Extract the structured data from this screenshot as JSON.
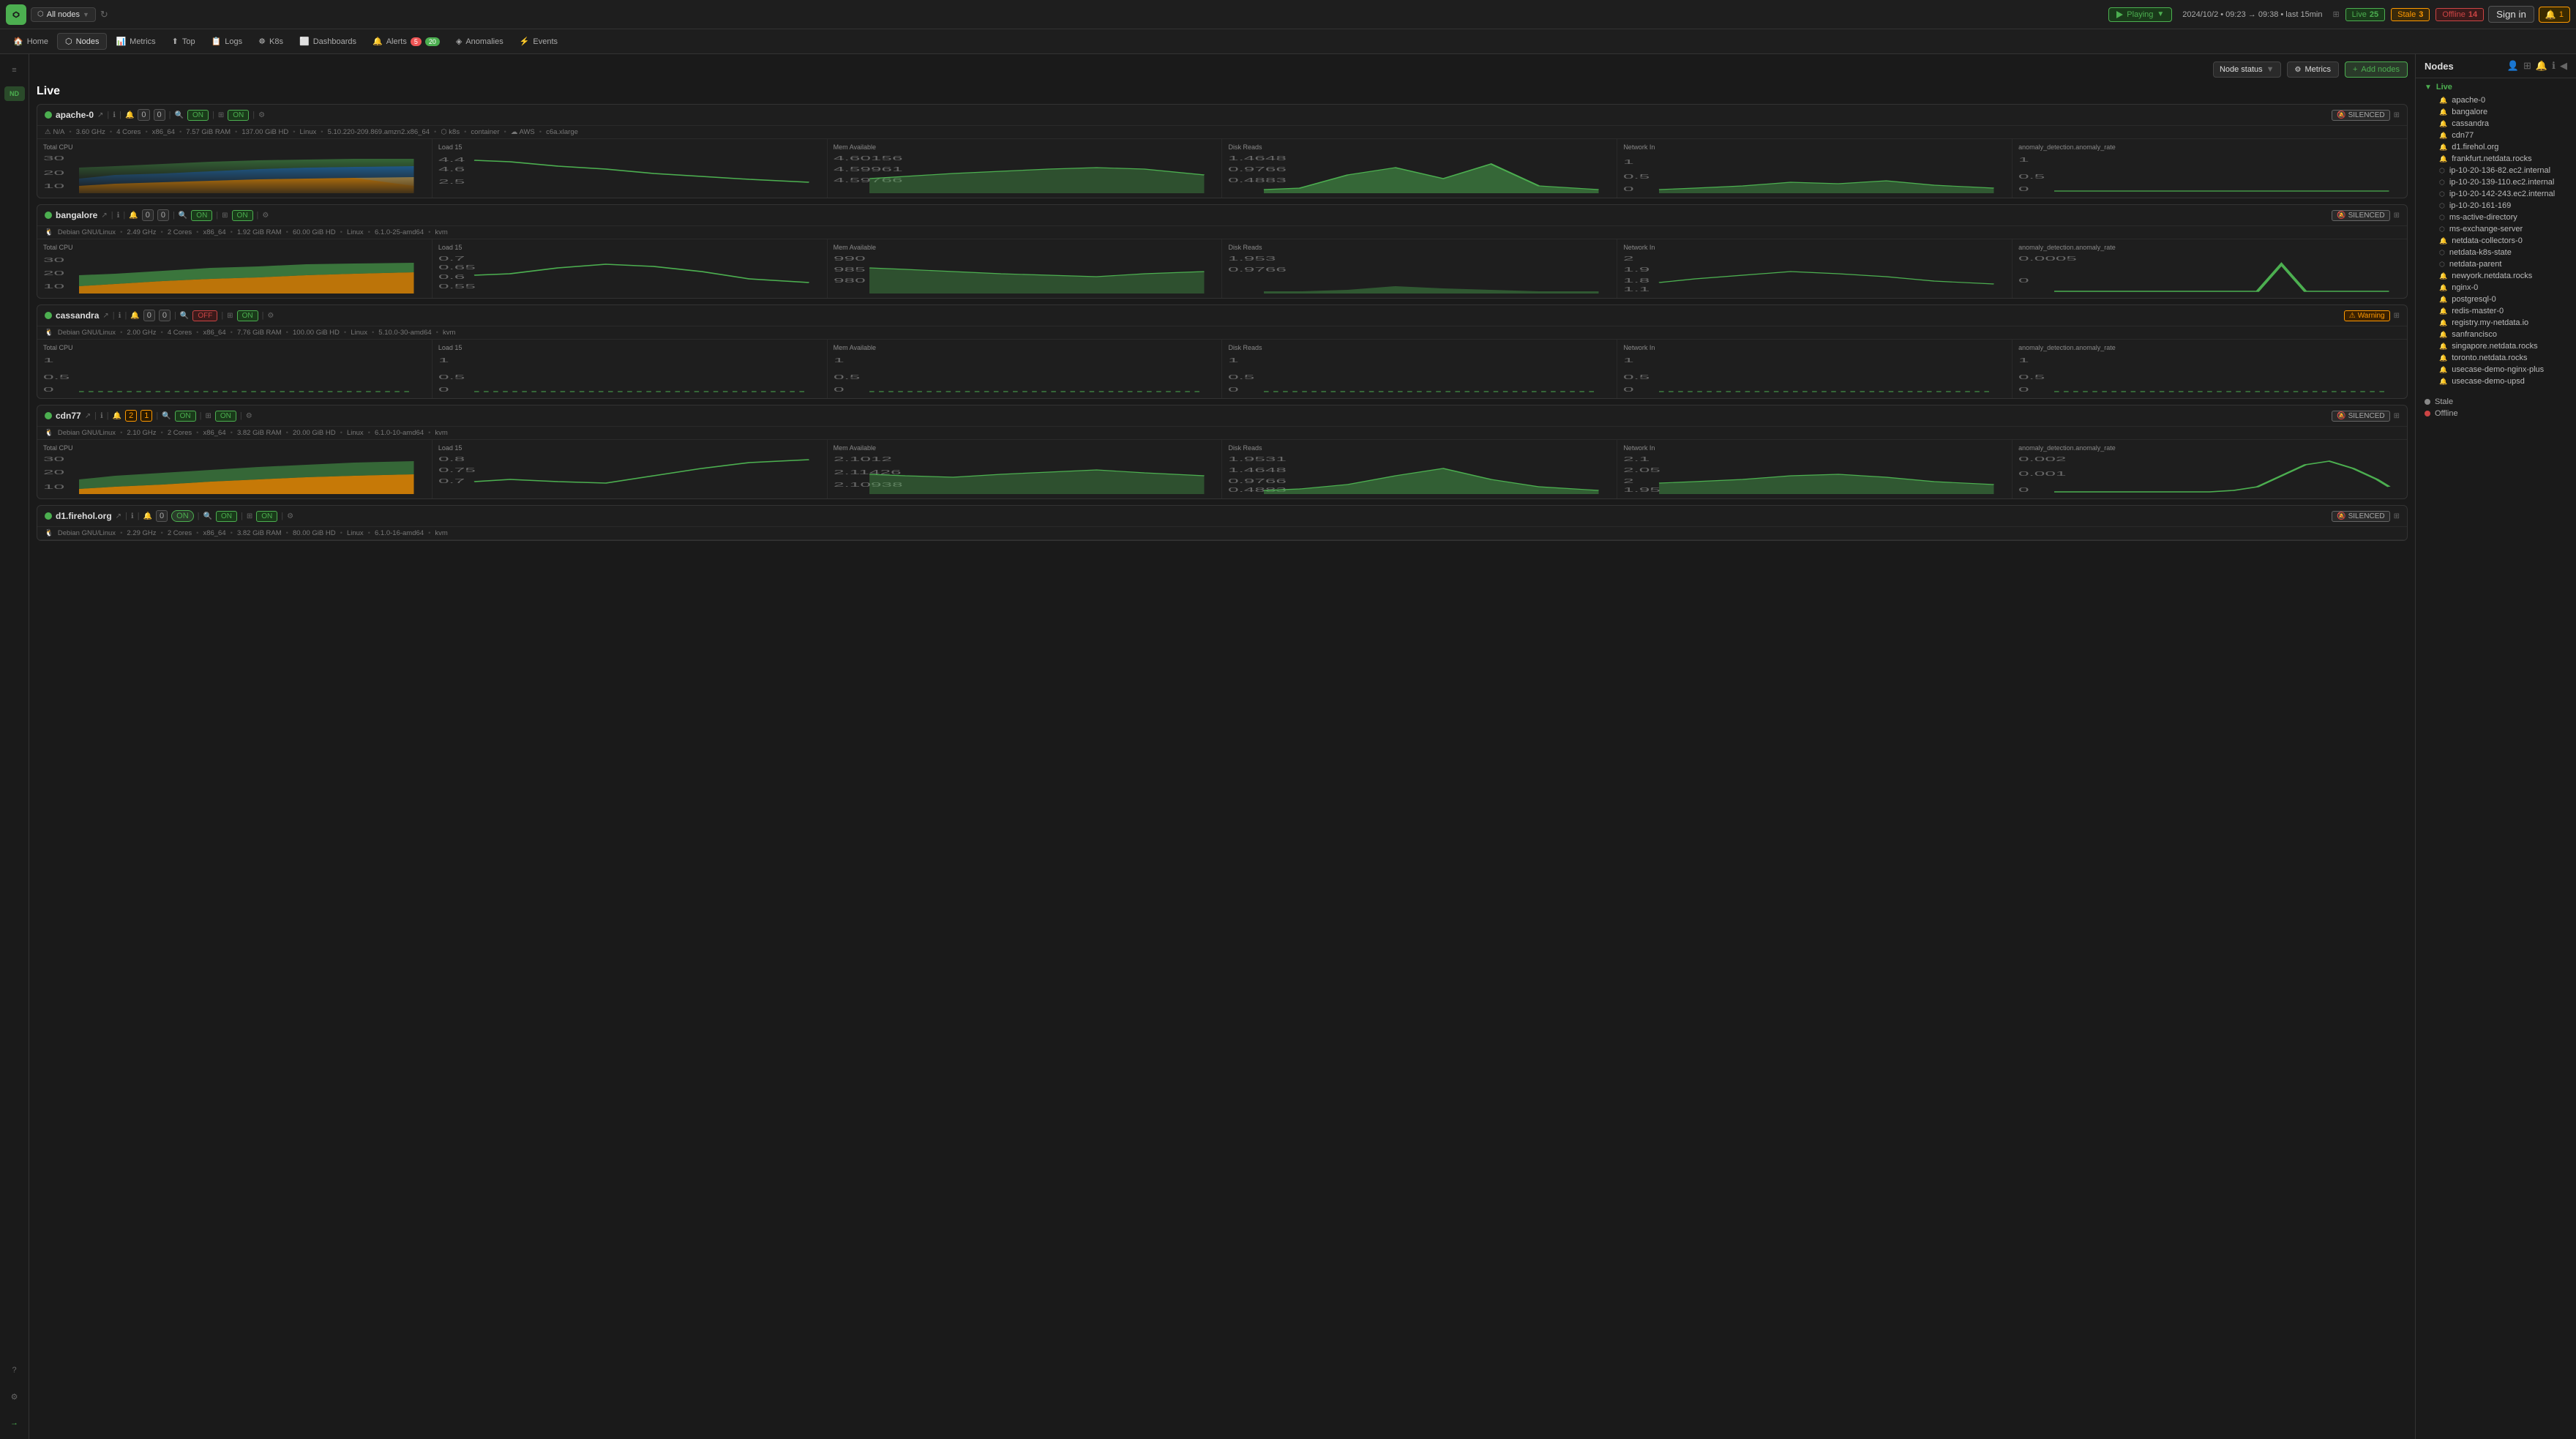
{
  "app": {
    "logo_alt": "Netdata",
    "node_selector": "All nodes",
    "playing_label": "Playing",
    "time_range": "2024/10/2 • 09:23 → 09:38 • last 15min",
    "live_label": "Live",
    "live_count": "25",
    "stale_label": "Stale",
    "stale_count": "3",
    "offline_label": "Offline",
    "offline_count": "14",
    "signin_label": "Sign in",
    "alert_count": "1"
  },
  "nav": {
    "items": [
      {
        "label": "Home",
        "icon": "🏠",
        "active": false
      },
      {
        "label": "Nodes",
        "icon": "⬡",
        "active": true
      },
      {
        "label": "Metrics",
        "icon": "📊",
        "active": false
      },
      {
        "label": "Top",
        "icon": "⬆",
        "active": false
      },
      {
        "label": "Logs",
        "icon": "📋",
        "active": false
      },
      {
        "label": "K8s",
        "icon": "☸",
        "active": false
      },
      {
        "label": "Dashboards",
        "icon": "⬜",
        "active": false
      },
      {
        "label": "Alerts",
        "icon": "🔔",
        "active": false,
        "badge": "5",
        "badge2": "20"
      },
      {
        "label": "Anomalies",
        "icon": "◈",
        "active": false
      },
      {
        "label": "Events",
        "icon": "⚡",
        "active": false
      }
    ]
  },
  "toolbar": {
    "node_status_label": "Node status",
    "metrics_label": "Metrics",
    "add_nodes_label": "Add nodes",
    "live_section_label": "Live"
  },
  "nodes": [
    {
      "id": "apache-0",
      "name": "apache-0",
      "status": "live",
      "alerts_critical": "0",
      "alerts_warning": "0",
      "query_on": true,
      "filter_on": true,
      "badge": "SILENCED",
      "info_line": "N/A • 3.60 GHz • 4 Cores • x86_64 • 7.57 GiB RAM • 137.00 GiB HD • Linux • 5.10.220-209.869.amzn2.x86_64 • k8s • container • AWS • c6a.xlarge",
      "charts": [
        {
          "title": "Total CPU",
          "type": "area_multi"
        },
        {
          "title": "Load 15",
          "type": "line"
        },
        {
          "title": "Mem Available",
          "type": "area"
        },
        {
          "title": "Disk Reads",
          "type": "area"
        },
        {
          "title": "Network In",
          "type": "area"
        },
        {
          "title": "anomaly_detection.anomaly_rate",
          "type": "line_flat"
        }
      ]
    },
    {
      "id": "bangalore",
      "name": "bangalore",
      "status": "live",
      "alerts_critical": "0",
      "alerts_warning": "0",
      "query_on": true,
      "filter_on": true,
      "badge": "SILENCED",
      "info_line": "Debian GNU/Linux • 2.49 GHz • 2 Cores • x86_64 • 1.92 GiB RAM • 60.00 GiB HD • Linux • 6.1.0-25-amd64 • kvm",
      "charts": [
        {
          "title": "Total CPU",
          "type": "area_multi"
        },
        {
          "title": "Load 15",
          "type": "line_wavy"
        },
        {
          "title": "Mem Available",
          "type": "area_flat"
        },
        {
          "title": "Disk Reads",
          "type": "area_small"
        },
        {
          "title": "Network In",
          "type": "line_bump"
        },
        {
          "title": "anomaly_detection.anomaly_rate",
          "type": "spike"
        }
      ]
    },
    {
      "id": "cassandra",
      "name": "cassandra",
      "status": "live",
      "alerts_critical": "0",
      "alerts_warning": "0",
      "query_off": true,
      "filter_on": true,
      "badge": "Warning",
      "badge_type": "warning",
      "info_line": "Debian GNU/Linux • 2.00 GHz • 4 Cores • x86_64 • 7.76 GiB RAM • 100.00 GiB HD • Linux • 5.10.0-30-amd64 • kvm",
      "charts": [
        {
          "title": "Total CPU",
          "type": "flat"
        },
        {
          "title": "Load 15",
          "type": "flat"
        },
        {
          "title": "Mem Available",
          "type": "flat"
        },
        {
          "title": "Disk Reads",
          "type": "flat"
        },
        {
          "title": "Network In",
          "type": "flat"
        },
        {
          "title": "anomaly_detection.anomaly_rate",
          "type": "flat"
        }
      ]
    },
    {
      "id": "cdn77",
      "name": "cdn77",
      "status": "live",
      "alerts_critical": "2",
      "alerts_warning": "1",
      "query_on": true,
      "filter_on": true,
      "badge": "SILENCED",
      "info_line": "Debian GNU/Linux • 2.10 GHz • 2 Cores • x86_64 • 3.82 GiB RAM • 20.00 GiB HD • Linux • 6.1.0-10-amd64 • kvm",
      "charts": [
        {
          "title": "Total CPU",
          "type": "area_orange"
        },
        {
          "title": "Load 15",
          "type": "line_dip"
        },
        {
          "title": "Mem Available",
          "type": "area_flat2"
        },
        {
          "title": "Disk Reads",
          "type": "area_wavy"
        },
        {
          "title": "Network In",
          "type": "area_wavy2"
        },
        {
          "title": "anomaly_detection.anomaly_rate",
          "type": "spike2"
        }
      ]
    },
    {
      "id": "d1.firehol.org",
      "name": "d1.firehol.org",
      "status": "live",
      "alerts_critical": "0",
      "alerts_warning": "0",
      "toggle_state": "on",
      "query_on": true,
      "filter_on": true,
      "badge": "SILENCED",
      "info_line": "Debian GNU/Linux • 2.29 GHz • 2 Cores • x86_64 • 3.82 GiB RAM • 80.00 GiB HD • Linux • 6.1.0-16-amd64 • kvm",
      "charts": []
    }
  ],
  "right_panel": {
    "title": "Nodes",
    "live_label": "Live",
    "live_nodes": [
      "apache-0",
      "bangalore",
      "cassandra",
      "cdn77",
      "d1.firehol.org",
      "frankfurt.netdata.rocks",
      "ip-10-20-136-82.ec2.internal",
      "ip-10-20-139-110.ec2.internal",
      "ip-10-20-142-243.ec2.internal",
      "ip-10-20-161-169",
      "ms-active-directory",
      "ms-exchange-server",
      "netdata-collectors-0",
      "netdata-k8s-state",
      "netdata-parent",
      "newyork.netdata.rocks",
      "nginx-0",
      "postgresql-0",
      "redis-master-0",
      "registry.my-netdata.io",
      "sanfrancisco",
      "singapore.netdata.rocks",
      "toronto.netdata.rocks",
      "usecase-demo-nginx-plus",
      "usecase-demo-upsd"
    ],
    "stale_label": "Stale",
    "offline_label": "Offline"
  }
}
